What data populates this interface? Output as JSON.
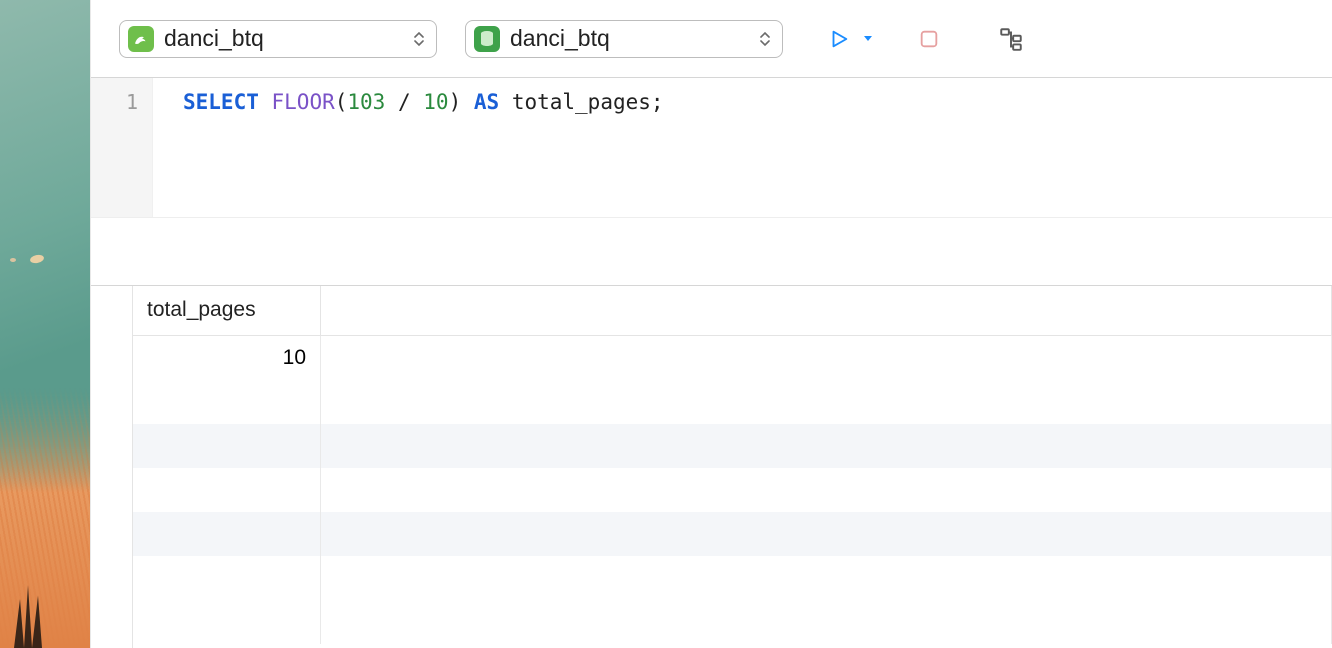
{
  "toolbar": {
    "connection": {
      "label": "danci_btq"
    },
    "schema": {
      "label": "danci_btq"
    }
  },
  "editor": {
    "line_number": "1",
    "tokens": {
      "select": "SELECT",
      "floor": "FLOOR",
      "lparen": "(",
      "n1": "103",
      "div": " / ",
      "n2": "10",
      "rparen": ")",
      "as": "AS",
      "alias": "total_pages",
      "semi": ";"
    }
  },
  "results": {
    "columns": [
      "total_pages"
    ],
    "rows": [
      {
        "total_pages": "10"
      }
    ]
  }
}
